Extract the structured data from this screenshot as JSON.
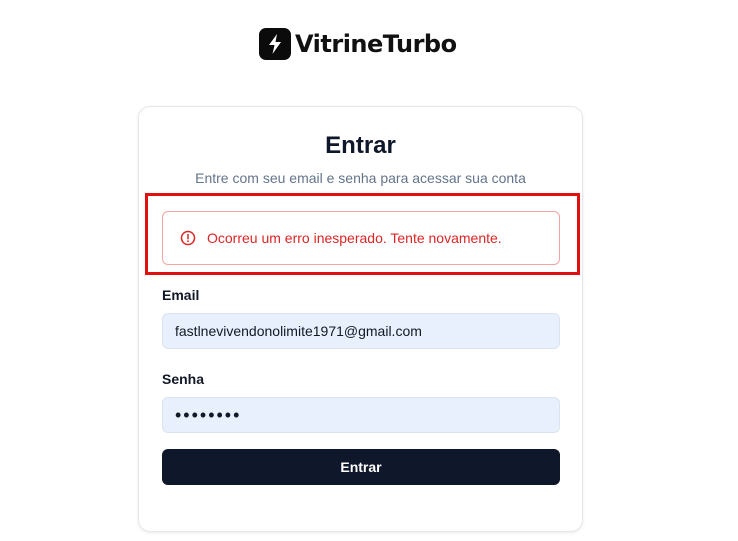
{
  "brand": {
    "name": "VitrineTurbo",
    "icon": "lightning-bolt-icon"
  },
  "login": {
    "title": "Entrar",
    "subtitle": "Entre com seu email e senha para acessar sua conta",
    "error": {
      "icon": "alert-circle-icon",
      "message": "Ocorreu um erro inesperado. Tente novamente.",
      "color": "#dc2626"
    },
    "email": {
      "label": "Email",
      "value": "fastlnevivendonolimite1971@gmail.com"
    },
    "password": {
      "label": "Senha",
      "value": "••••••••"
    },
    "submit_label": "Entrar"
  },
  "colors": {
    "highlight": "#e01010",
    "button": "#0f172a",
    "input_bg": "#e8f0fe"
  }
}
